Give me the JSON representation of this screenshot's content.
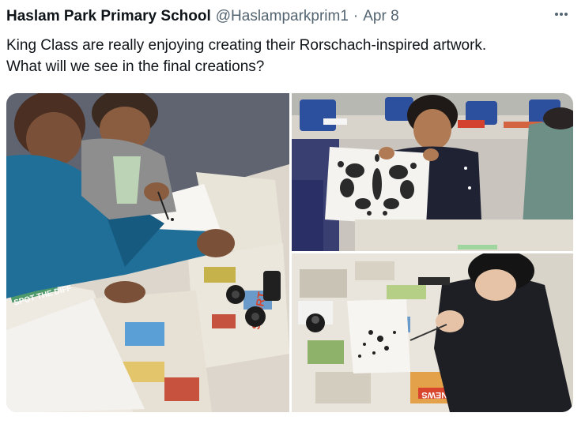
{
  "tweet": {
    "author_name": "Haslam Park Primary School",
    "handle": "@Haslamparkprim1",
    "separator": "·",
    "date": "Apr 8",
    "more_icon": "more-horizontal-icon",
    "text_lines": [
      "King Class are really enjoying creating their Rorschach-inspired artwork.",
      "What will we see in the final creations?"
    ]
  },
  "media": {
    "photos": [
      {
        "description_icon": "photo-children-ink-blots"
      },
      {
        "description_icon": "photo-girl-holding-inkblot"
      },
      {
        "description_icon": "photo-boy-painting-inkblot"
      }
    ],
    "newspaper_snippets": [
      "SPOT THE DIFF",
      "SPORT",
      "QUICK NEWS"
    ]
  },
  "colors": {
    "text_primary": "#0f1419",
    "text_secondary": "#536471"
  }
}
